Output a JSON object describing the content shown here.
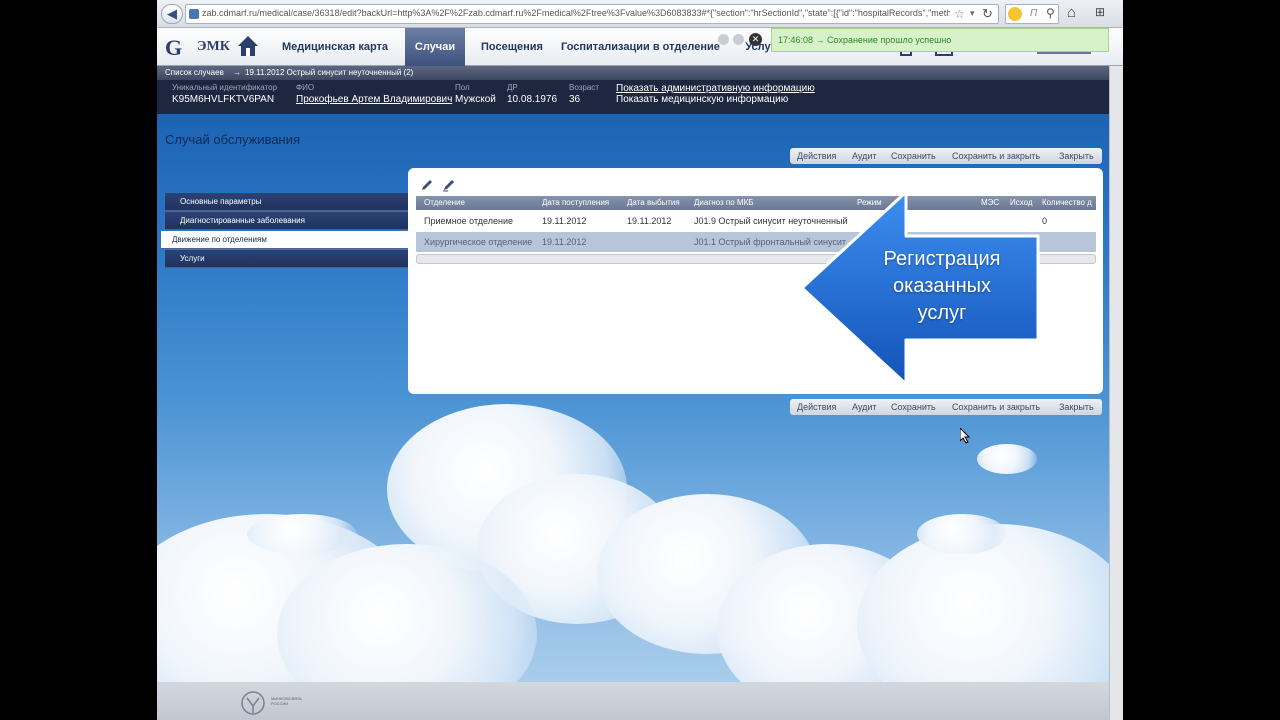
{
  "browser": {
    "url": "zab.cdmarf.ru/medical/case/36318/edit?backUrl=http%3A%2F%2Fzab.cdmarf.ru%2Fmedical%2Ftree%3Fvalue%3D6083833#*{\"section\":\"hrSectionId\",\"state\":[{\"id\":\"hospitalRecords\",\"metho",
    "search_placeholder": "П"
  },
  "header": {
    "app_name": "ЭМК",
    "tabs": [
      {
        "label": "Медицинская карта",
        "active": false
      },
      {
        "label": "Случаи",
        "active": true
      },
      {
        "label": "Посещения",
        "active": false
      },
      {
        "label": "Госпитализации в отделение",
        "active": false
      },
      {
        "label": "Услу",
        "active": false
      }
    ]
  },
  "toast": {
    "text": "17:46:08 → Сохранение прошло успешно"
  },
  "breadcrumb": {
    "root": "Список случаев",
    "separator": "→",
    "current": "19.11.2012 Острый синусит неуточненный (2)"
  },
  "patient": {
    "uid_label": "Уникальный идентификатор",
    "uid_value": "K95M6HVLFKTV6PAN",
    "fio_label": "ФИО",
    "fio_value": "Прокофьев Артем Владимирович",
    "sex_label": "Пол",
    "sex_value": "Мужской",
    "dob_label": "ДР",
    "dob_value": "10.08.1976",
    "age_label": "Возраст",
    "age_value": "36",
    "link_admin": "Показать административную информацию",
    "link_medical": "Показать медицинскую информацию"
  },
  "page": {
    "title": "Случай обслуживания",
    "actions": [
      "Действия",
      "Аудит",
      "Сохранить",
      "Сохранить и закрыть",
      "Закрыть"
    ]
  },
  "sidenav": [
    {
      "label": "Основные параметры",
      "active": false
    },
    {
      "label": "Диагностированные заболевания",
      "active": false
    },
    {
      "label": "Движение по отделениям",
      "active": true
    },
    {
      "label": "Услуги",
      "active": false
    }
  ],
  "grid": {
    "columns": [
      "Отделение",
      "Дата поступления",
      "Дата выбытия",
      "Диагноз по МКБ",
      "Режим",
      "МЭС",
      "Исход",
      "Количество д"
    ],
    "rows": [
      {
        "dept": "Приемное отделение",
        "admit": "19.11.2012",
        "discharge": "19.11.2012",
        "diag": "J01.9 Острый синусит неуточненный",
        "qty": "0"
      },
      {
        "dept": "Хирургическое отделение",
        "admit": "19.11.2012",
        "discharge": "",
        "diag": "J01.1 Острый фронтальный синусит",
        "qty": ""
      }
    ]
  },
  "callout": {
    "line1": "Регистрация",
    "line2": "оказанных",
    "line3": "услуг",
    "color": "#1f6fd6"
  },
  "footer": {
    "org_text": "Минкомсвязь России"
  },
  "icons": [
    "back-icon",
    "star-icon",
    "reload-icon",
    "home-icon",
    "logo-icon",
    "house-icon",
    "edit-icon",
    "arrow-icon",
    "cursor-icon",
    "emblem-icon"
  ]
}
